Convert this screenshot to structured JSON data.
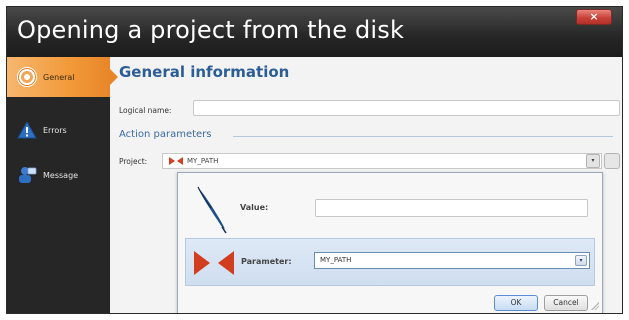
{
  "window": {
    "title": "Opening a project from the disk",
    "close_label": "×"
  },
  "sidebar": {
    "items": [
      {
        "label": "General",
        "icon": "target-icon",
        "active": true
      },
      {
        "label": "Errors",
        "icon": "warning-icon",
        "active": false
      },
      {
        "label": "Message",
        "icon": "user-message-icon",
        "active": false
      }
    ]
  },
  "main": {
    "section_title": "General information",
    "logical_name_label": "Logical name:",
    "logical_name_value": "",
    "action_params_title": "Action parameters",
    "project_label": "Project:",
    "project_value": "MY_PATH",
    "project_dropdown_glyph": "▾"
  },
  "popup": {
    "value_label": "Value:",
    "value_text": "",
    "parameter_label": "Parameter:",
    "parameter_value": "MY_PATH",
    "parameter_dropdown_glyph": "▾",
    "ok_label": "OK",
    "cancel_label": "Cancel"
  },
  "colors": {
    "accent_orange": "#f29a3a",
    "title_blue": "#2d5d95",
    "arrow_red": "#d23c1f",
    "dark_bg": "#262626"
  }
}
